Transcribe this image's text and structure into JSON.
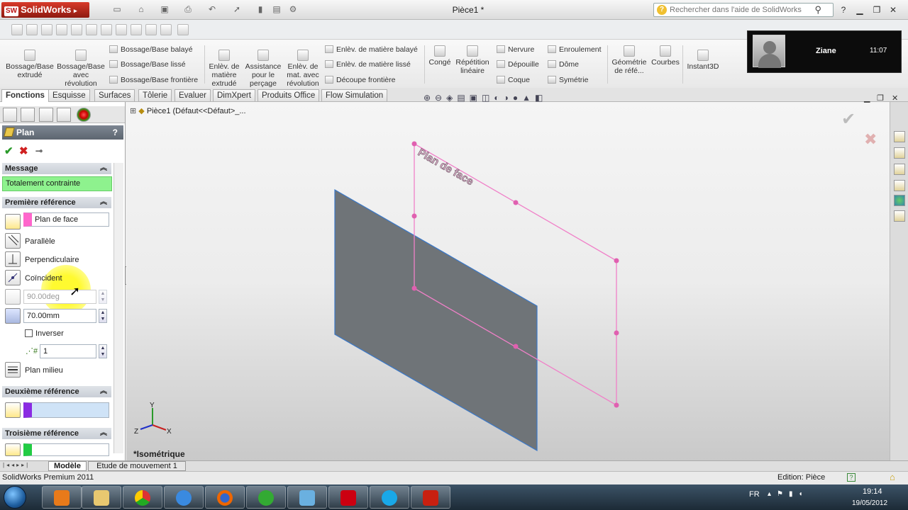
{
  "app": {
    "brand": "SolidWorks",
    "document_title": "Pièce1 *",
    "search_placeholder": "Rechercher dans l'aide de SolidWorks",
    "help": "?"
  },
  "ribbon": {
    "extrude_boss": "Bossage/Base extrudé",
    "revolve_boss": "Bossage/Base avec révolution",
    "swept_boss": "Bossage/Base balayé",
    "loft_boss": "Bossage/Base lissé",
    "boundary_boss": "Bossage/Base frontière",
    "extrude_cut": "Enlèv. de matière extrudé",
    "hole_wizard": "Assistance pour le perçage",
    "revolve_cut": "Enlèv. de mat. avec révolution",
    "swept_cut": "Enlèv. de matière balayé",
    "loft_cut": "Enlèv. de matière lissé",
    "boundary_cut": "Découpe frontière",
    "fillet": "Congé",
    "linear_pattern": "Répétition linéaire",
    "rib": "Nervure",
    "draft": "Dépouille",
    "shell": "Coque",
    "wrap": "Enroulement",
    "dome": "Dôme",
    "mirror": "Symétrie",
    "ref_geometry": "Géométrie de réfé...",
    "curves": "Courbes",
    "instant3d": "Instant3D"
  },
  "notification": {
    "name": "Ziane",
    "time": "11:07"
  },
  "tabs": [
    "Fonctions",
    "Esquisse",
    "Surfaces",
    "Tôlerie",
    "Evaluer",
    "DimXpert",
    "Produits Office",
    "Flow Simulation"
  ],
  "tree_breadcrumb": "Pièce1  (Défaut<<Défaut>_...",
  "panel": {
    "title": "Plan",
    "help": "?",
    "message_header": "Message",
    "message": "Totalement contrainte",
    "first_ref_header": "Première référence",
    "first_ref_value": "Plan de face",
    "parallel": "Parallèle",
    "perpendicular": "Perpendiculaire",
    "coincident": "Coïncident",
    "angle": "90.00deg",
    "distance": "70.00mm",
    "flip": "Inverser",
    "count": "1",
    "mid_plane": "Plan milieu",
    "second_ref_header": "Deuxième référence",
    "third_ref_header": "Troisième référence"
  },
  "viewport": {
    "plane_label": "Plan de face",
    "view_name": "*Isométrique",
    "triad": {
      "x": "X",
      "y": "Y",
      "z": "Z"
    }
  },
  "bottom_tabs": [
    "Modèle",
    "Etude de mouvement 1"
  ],
  "status": {
    "left": "SolidWorks Premium 2011",
    "mode": "Edition: Pièce"
  },
  "taskbar": {
    "lang": "FR",
    "time": "19:14",
    "date": "19/05/2012"
  },
  "colors": {
    "ref_pink": "#ff66cc",
    "ref_purple": "#8a2be2",
    "ref_green": "#22cc44",
    "message_green": "#8ef28e",
    "plane_gray": "#6f7478",
    "preview_pink": "#f080c8"
  }
}
